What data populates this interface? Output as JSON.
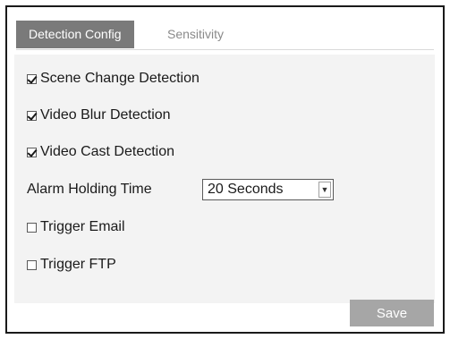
{
  "tabs": [
    {
      "label": "Detection Config",
      "active": true
    },
    {
      "label": "Sensitivity",
      "active": false
    }
  ],
  "options": {
    "scene_change": {
      "label": "Scene Change Detection",
      "checked": true
    },
    "video_blur": {
      "label": "Video Blur Detection",
      "checked": true
    },
    "video_cast": {
      "label": "Video Cast Detection",
      "checked": true
    },
    "alarm_holding_time": {
      "label": "Alarm Holding Time",
      "value": "20 Seconds"
    },
    "trigger_email": {
      "label": "Trigger Email",
      "checked": false
    },
    "trigger_ftp": {
      "label": "Trigger FTP",
      "checked": false
    }
  },
  "save_label": "Save",
  "colors": {
    "active_tab_bg": "#7a7a7a",
    "inactive_tab_text": "#8a8a8a",
    "panel_bg": "#f3f3f3",
    "save_button_bg": "#a6a6a6"
  }
}
